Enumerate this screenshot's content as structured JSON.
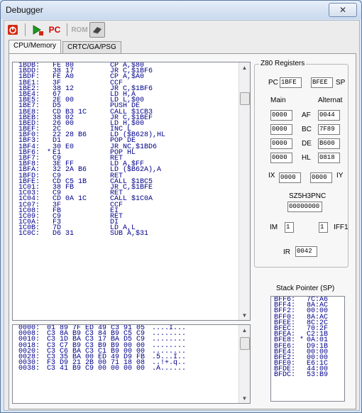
{
  "window": {
    "title": "Debugger",
    "close_glyph": "✕"
  },
  "toolbar": {
    "buttons": [
      {
        "name": "stop-button",
        "icon": "power-icon",
        "glyph": "⏻",
        "color": "#cc2200"
      },
      {
        "name": "step-button",
        "icon": "step-icon",
        "glyph": "⇲",
        "color": "#1f8f1f"
      },
      {
        "name": "pc-button",
        "icon": "pc-icon",
        "glyph": "PC",
        "color": "#cc0000"
      },
      {
        "name": "rom-button",
        "icon": "rom-icon",
        "glyph": "ROM",
        "color": "#a9a9a9"
      },
      {
        "name": "eraser-button",
        "icon": "eraser-icon",
        "glyph": "◩",
        "color": "#333333"
      }
    ]
  },
  "tabs": [
    {
      "label": "CPU/Memory",
      "selected": true
    },
    {
      "label": "CRTC/GA/PSG",
      "selected": false
    }
  ],
  "disassembly": [
    {
      "addr": "1BDB:",
      "mark": "",
      "bytes": "FE 80",
      "instr": "CP A,$80"
    },
    {
      "addr": "1BDD:",
      "mark": "",
      "bytes": "38 17",
      "instr": "JR C,$1BF6"
    },
    {
      "addr": "1BDF:",
      "mark": "",
      "bytes": "FE A0",
      "instr": "CP A,$A0"
    },
    {
      "addr": "1BE1:",
      "mark": "",
      "bytes": "3F",
      "instr": "CCF"
    },
    {
      "addr": "1BE2:",
      "mark": "",
      "bytes": "38 12",
      "instr": "JR C,$1BF6"
    },
    {
      "addr": "1BE4:",
      "mark": "",
      "bytes": "67",
      "instr": "LD H,A"
    },
    {
      "addr": "1BE5:",
      "mark": "",
      "bytes": "2E 00",
      "instr": "LD L,$00"
    },
    {
      "addr": "1BE7:",
      "mark": "",
      "bytes": "D5",
      "instr": "PUSH DE"
    },
    {
      "addr": "1BE8:",
      "mark": "",
      "bytes": "CD B3 1C",
      "instr": "CALL $1CB3"
    },
    {
      "addr": "1BEB:",
      "mark": "",
      "bytes": "38 02",
      "instr": "JR C,$1BEF"
    },
    {
      "addr": "1BED:",
      "mark": "",
      "bytes": "26 00",
      "instr": "LD H,$00"
    },
    {
      "addr": "1BEF:",
      "mark": "",
      "bytes": "2C",
      "instr": "INC L"
    },
    {
      "addr": "1BF0:",
      "mark": "",
      "bytes": "22 28 B6",
      "instr": "LD ($B628),HL"
    },
    {
      "addr": "1BF3:",
      "mark": "",
      "bytes": "D1",
      "instr": "POP DE"
    },
    {
      "addr": "1BF4:",
      "mark": "",
      "bytes": "30 E0",
      "instr": "JR NC,$1BD6"
    },
    {
      "addr": "1BF6:",
      "mark": "*",
      "bytes": "E1",
      "instr": "POP HL"
    },
    {
      "addr": "1BF7:",
      "mark": "",
      "bytes": "C9",
      "instr": "RET"
    },
    {
      "addr": "1BF8:",
      "mark": "",
      "bytes": "3E FF",
      "instr": "LD A,$FF"
    },
    {
      "addr": "1BFA:",
      "mark": "",
      "bytes": "32 2A B6",
      "instr": "LD ($B62A),A"
    },
    {
      "addr": "1BFD:",
      "mark": "",
      "bytes": "C9",
      "instr": "RET"
    },
    {
      "addr": "1BFE:",
      "mark": "",
      "bytes": "CD C5 1B",
      "instr": "CALL $1BC5"
    },
    {
      "addr": "1C01:",
      "mark": "",
      "bytes": "38 FB",
      "instr": "JR C,$1BFE"
    },
    {
      "addr": "1C03:",
      "mark": "",
      "bytes": "C9",
      "instr": "RET"
    },
    {
      "addr": "1C04:",
      "mark": "",
      "bytes": "CD 0A 1C",
      "instr": "CALL $1C0A"
    },
    {
      "addr": "1C07:",
      "mark": "",
      "bytes": "3F",
      "instr": "CCF"
    },
    {
      "addr": "1C08:",
      "mark": "",
      "bytes": "FB",
      "instr": "EI"
    },
    {
      "addr": "1C09:",
      "mark": "",
      "bytes": "C9",
      "instr": "RET"
    },
    {
      "addr": "1C0A:",
      "mark": "",
      "bytes": "F3",
      "instr": "DI"
    },
    {
      "addr": "1C0B:",
      "mark": "",
      "bytes": "7D",
      "instr": "LD A,L"
    },
    {
      "addr": "1C0C:",
      "mark": "",
      "bytes": "D6 31",
      "instr": "SUB A,$31"
    }
  ],
  "memory_dump": [
    {
      "addr": "0000:",
      "bytes": "01 89 7F ED 49 C3 91 05",
      "ascii": "....I..."
    },
    {
      "addr": "0008:",
      "bytes": "C3 8A B9 C3 84 B9 C5 C9",
      "ascii": "........"
    },
    {
      "addr": "0010:",
      "bytes": "C3 1D BA C3 17 BA D5 C9",
      "ascii": "........"
    },
    {
      "addr": "0018:",
      "bytes": "C3 C7 B9 C3 B9 B9 00 00",
      "ascii": "........"
    },
    {
      "addr": "0020:",
      "bytes": "C3 C6 BA C3 C1 B9 00 00",
      "ascii": "........"
    },
    {
      "addr": "0028:",
      "bytes": "C3 35 BA 00 ED 49 D9 FB",
      "ascii": ".5...I.."
    },
    {
      "addr": "0030:",
      "bytes": "F3 D9 21 2B 00 71 18 08",
      "ascii": "..!+.q.."
    },
    {
      "addr": "0038:",
      "bytes": "C3 41 B9 C9 00 00 00 00",
      "ascii": ".A......"
    }
  ],
  "z80": {
    "group_title": "Z80 Registers",
    "pc_label": "PC",
    "pc_value": "1BFE",
    "sp_label": "SP",
    "sp_value": "BFEE",
    "main_label": "Main",
    "alt_label": "Alternat",
    "regs": [
      {
        "name": "AF",
        "main": "0000",
        "alt": "0044"
      },
      {
        "name": "BC",
        "main": "0000",
        "alt": "7F89"
      },
      {
        "name": "DE",
        "main": "0000",
        "alt": "B600"
      },
      {
        "name": "HL",
        "main": "0000",
        "alt": "0818"
      }
    ],
    "ix_label": "IX",
    "ix_value": "0000",
    "iy_label": "IY",
    "iy_value": "0000",
    "flags_label": "SZ5H3PNC",
    "flags_value": "00000000",
    "im_label": "IM",
    "im_value": "1",
    "iff_label": "IFF1",
    "iff_value": "1",
    "ir_label": "IR",
    "ir_value": "0042"
  },
  "stack": {
    "title": "Stack Pointer (SP)",
    "rows": [
      {
        "addr": "BFF6:",
        "mark": "",
        "val": "7C:A6"
      },
      {
        "addr": "BFF4:",
        "mark": "",
        "val": "8A:AC"
      },
      {
        "addr": "BFF2:",
        "mark": "",
        "val": "00:00"
      },
      {
        "addr": "BFF0:",
        "mark": "",
        "val": "8A:AC"
      },
      {
        "addr": "BFEE:",
        "mark": "",
        "val": "8C:2C"
      },
      {
        "addr": "BFEC:",
        "mark": "",
        "val": "70:2F"
      },
      {
        "addr": "BFEA:",
        "mark": "",
        "val": "C2:1B"
      },
      {
        "addr": "BFE8:",
        "mark": "*",
        "val": "0A:01"
      },
      {
        "addr": "BFE6:",
        "mark": "",
        "val": "D9:1B"
      },
      {
        "addr": "BFE4:",
        "mark": "",
        "val": "00:00"
      },
      {
        "addr": "BFE2:",
        "mark": "",
        "val": "00:00"
      },
      {
        "addr": "BFE0:",
        "mark": "",
        "val": "E6:1C"
      },
      {
        "addr": "BFDE:",
        "mark": "",
        "val": "44:00"
      },
      {
        "addr": "BFDC:",
        "mark": "",
        "val": "53:B9"
      }
    ]
  }
}
